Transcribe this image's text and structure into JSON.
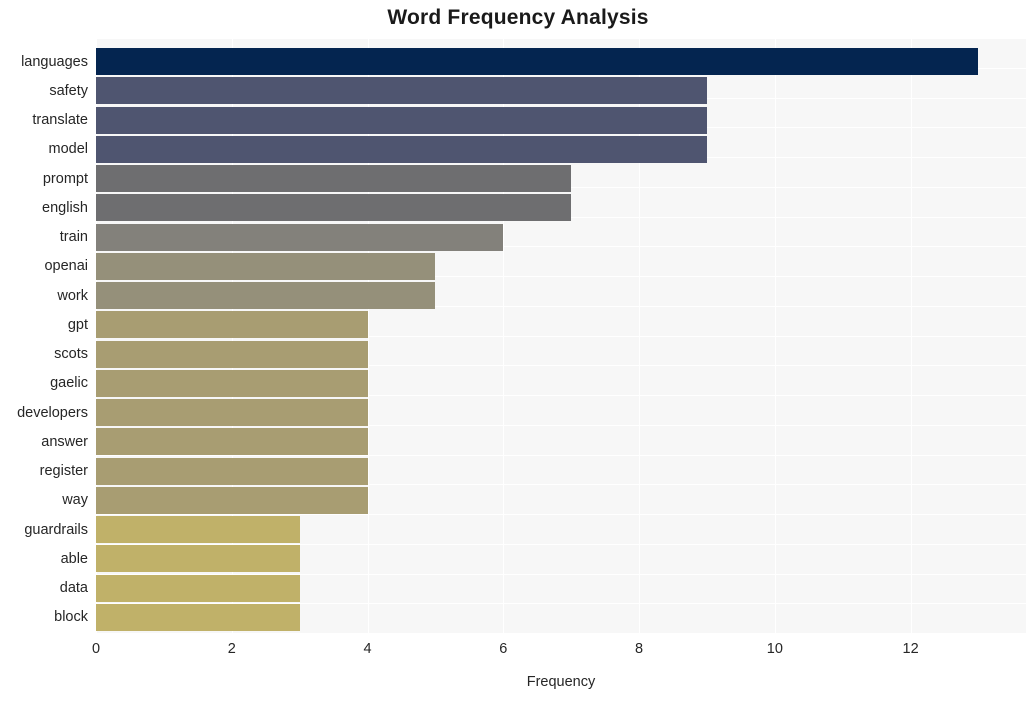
{
  "chart_data": {
    "type": "bar",
    "orientation": "horizontal",
    "title": "Word Frequency Analysis",
    "xlabel": "Frequency",
    "ylabel": "",
    "categories": [
      "languages",
      "safety",
      "translate",
      "model",
      "prompt",
      "english",
      "train",
      "openai",
      "work",
      "gpt",
      "scots",
      "gaelic",
      "developers",
      "answer",
      "register",
      "way",
      "guardrails",
      "able",
      "data",
      "block"
    ],
    "values": [
      13,
      9,
      9,
      9,
      7,
      7,
      6,
      5,
      5,
      4,
      4,
      4,
      4,
      4,
      4,
      4,
      3,
      3,
      3,
      3
    ],
    "bar_colors": [
      "#042550",
      "#4f5570",
      "#4f5570",
      "#4f5570",
      "#6e6e70",
      "#6e6e70",
      "#83817b",
      "#95907a",
      "#95907a",
      "#a89d72",
      "#a89d72",
      "#a89d72",
      "#a89d72",
      "#a89d72",
      "#a89d72",
      "#a89d72",
      "#c0b169",
      "#c0b169",
      "#c0b169",
      "#c0b169"
    ],
    "xlim": [
      0,
      13.7
    ],
    "xticks": [
      0,
      2,
      4,
      6,
      8,
      10,
      12
    ],
    "xtick_labels": [
      "0",
      "2",
      "4",
      "6",
      "8",
      "10",
      "12"
    ],
    "grid": true,
    "grid_color": "#ffffff",
    "legend": "none",
    "plot_background": "#f7f7f7",
    "figure_background": "#ffffff",
    "title_color": "#1a1a1a",
    "tick_color": "#262626"
  }
}
